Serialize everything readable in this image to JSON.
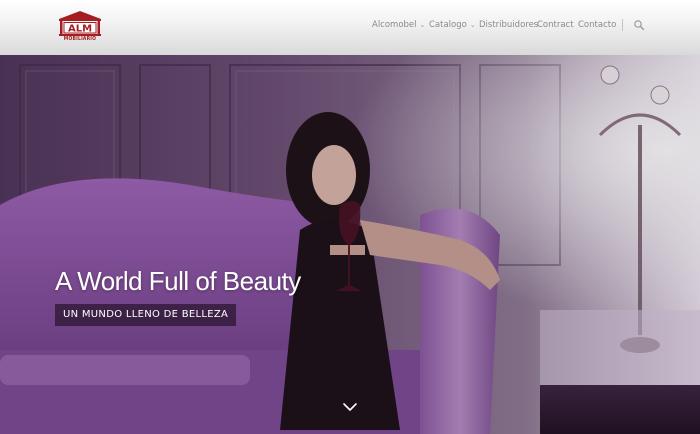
{
  "brand": {
    "logo_text": "ALM",
    "logo_subtext": "MOBILIARIO",
    "brand_color": "#a51d21"
  },
  "nav": {
    "items": [
      {
        "label": "Alcomobel",
        "has_dropdown": true
      },
      {
        "label": "Catalogo",
        "has_dropdown": true
      },
      {
        "label": "Distribuidores",
        "has_dropdown": false
      },
      {
        "label": "Contract",
        "has_dropdown": false
      },
      {
        "label": "Contacto",
        "has_dropdown": false
      }
    ],
    "search_icon": "search-icon",
    "dropdown_icon": "chevron-down-icon"
  },
  "hero": {
    "title": "A World Full of Beauty",
    "subtitle": "UN MUNDO LLENO DE BELLEZA",
    "scroll_icon": "chevron-down-icon",
    "accent_color": "#7a4a8e"
  }
}
